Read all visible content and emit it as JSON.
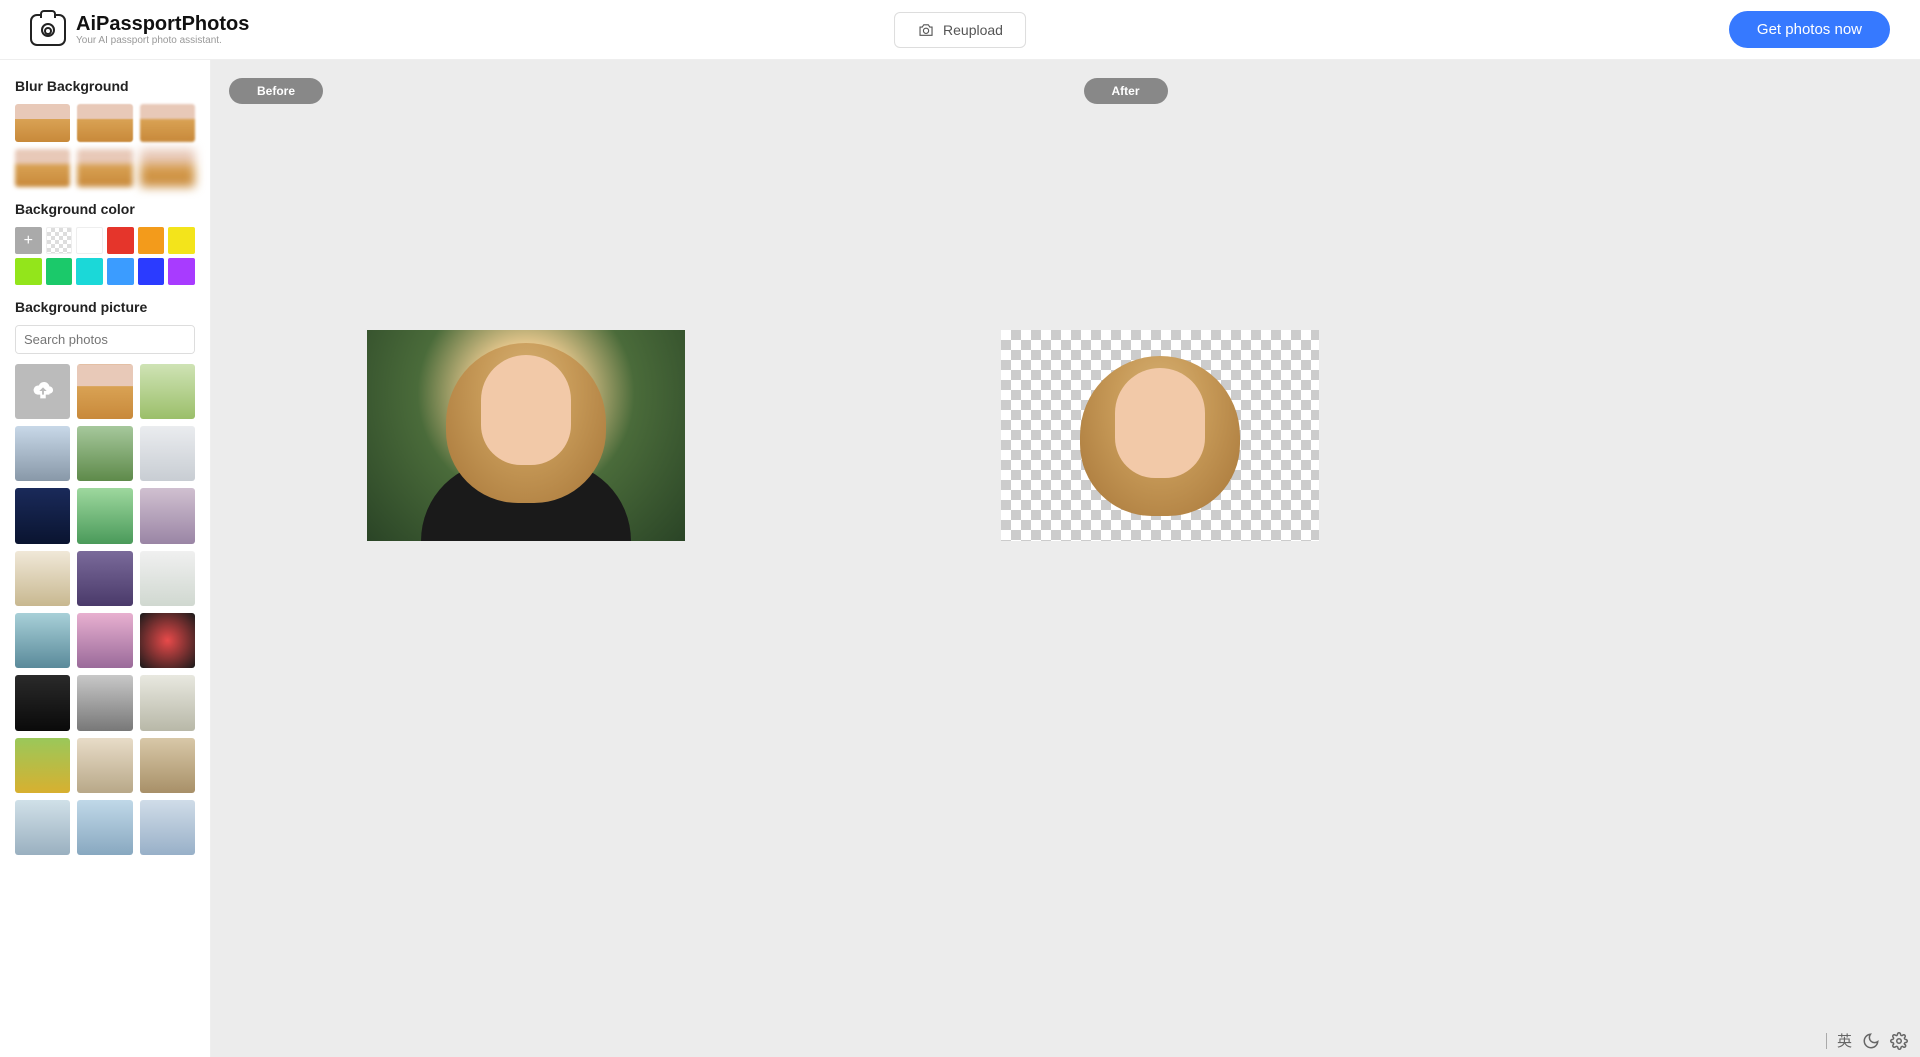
{
  "header": {
    "logo_title": "AiPassportPhotos",
    "logo_sub": "Your AI passport photo assistant.",
    "reupload_label": "Reupload",
    "get_photos_label": "Get photos now"
  },
  "sidebar": {
    "blur_title": "Blur Background",
    "color_title": "Background color",
    "colors": [
      {
        "name": "add",
        "value": "add"
      },
      {
        "name": "transparent",
        "value": "transparent"
      },
      {
        "name": "white",
        "value": "#ffffff"
      },
      {
        "name": "red",
        "value": "#e5352b"
      },
      {
        "name": "orange",
        "value": "#f39b1b"
      },
      {
        "name": "yellow",
        "value": "#f3e41b"
      },
      {
        "name": "lime",
        "value": "#93e51b"
      },
      {
        "name": "green",
        "value": "#1bc96a"
      },
      {
        "name": "cyan",
        "value": "#1bd8d8"
      },
      {
        "name": "sky",
        "value": "#3b9cff"
      },
      {
        "name": "blue",
        "value": "#2b3bff"
      },
      {
        "name": "purple",
        "value": "#a83bff"
      }
    ],
    "picture_title": "Background picture",
    "search_placeholder": "Search photos"
  },
  "canvas": {
    "before_label": "Before",
    "after_label": "After"
  },
  "tray": {
    "ime": "英"
  }
}
